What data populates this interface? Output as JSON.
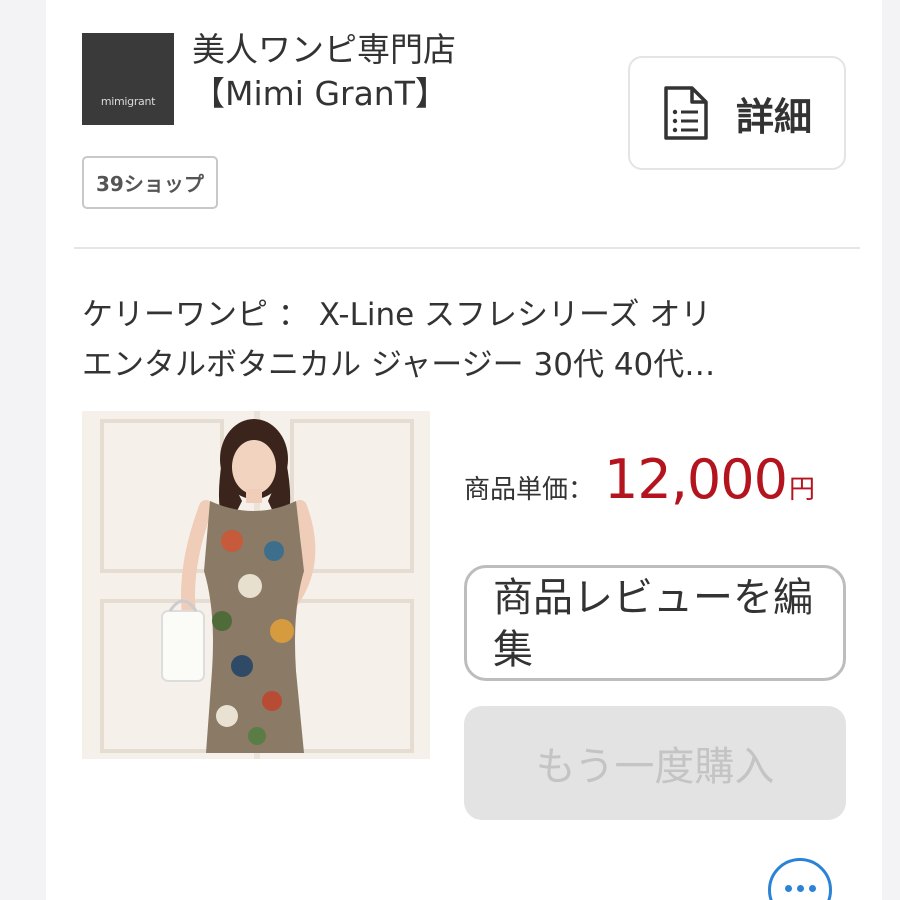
{
  "shop": {
    "logo_text": "mimigrant",
    "name_line1": "美人ワンピ専門店",
    "name_line2": "【Mimi GranT】",
    "badge": "39ショップ",
    "detail_label": "詳細",
    "detail_icon": "document-list-icon"
  },
  "product": {
    "title_line1": "ケリーワンピ ： X-Line スフレシリーズ オリ",
    "title_line2": "エンタルボタニカル ジャージー 30代 40代…",
    "price_label": "商品単価：",
    "price_value": "12,000",
    "price_unit": "円",
    "image_alt": "product-photo"
  },
  "actions": {
    "review_label": "商品レビューを編集",
    "rebuy_label": "もう一度購入",
    "more_icon": "more-dots-icon"
  },
  "colors": {
    "price": "#b4141e",
    "more_accent": "#2b83d6",
    "disabled_bg": "#e3e3e3",
    "disabled_text": "#c4c4c4"
  }
}
